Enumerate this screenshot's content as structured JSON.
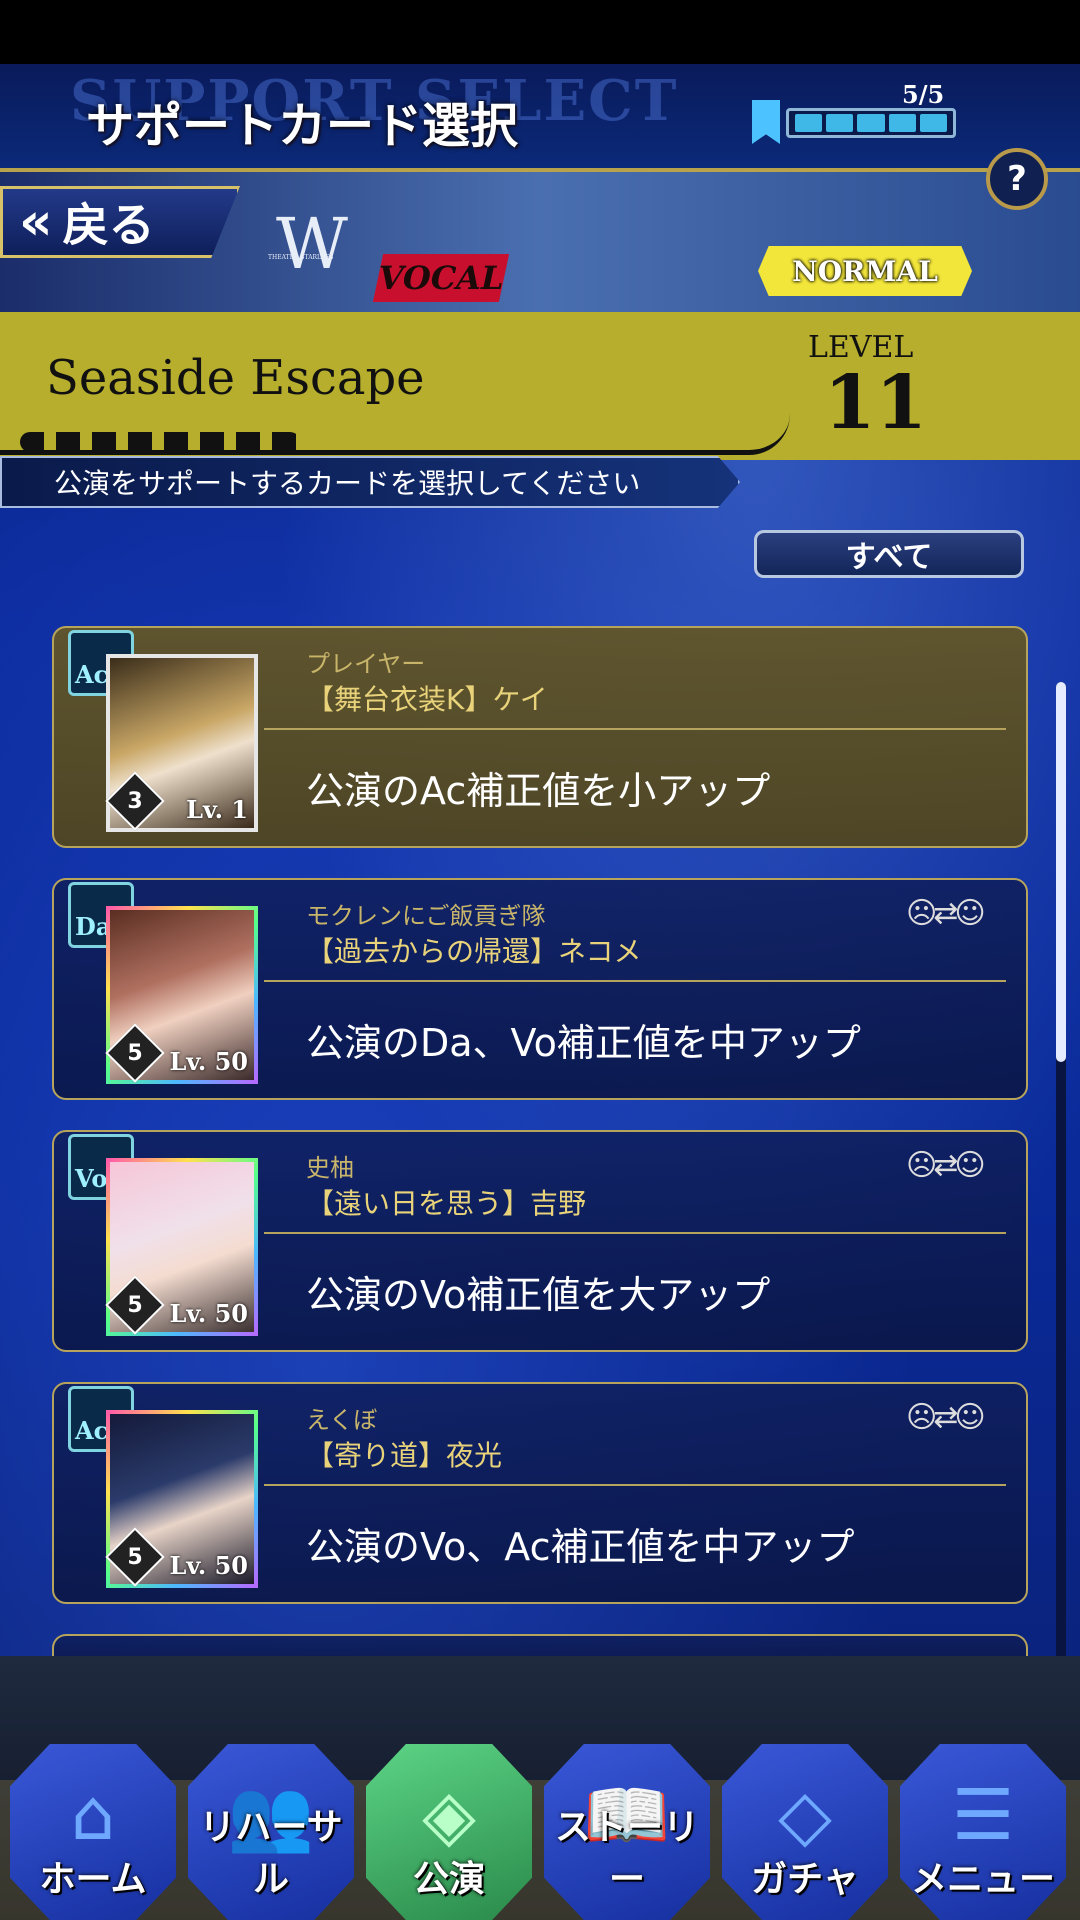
{
  "header": {
    "bg_text": "SUPPORT SELECT",
    "title": "サポートカード選択",
    "stamina": "5/5",
    "help": "?"
  },
  "top": {
    "back_label": "戻る",
    "logo_small": "THEATER STARLESS",
    "attribute": "VOCAL",
    "difficulty": "NORMAL"
  },
  "song": {
    "title": "Seaside Escape",
    "level_label": "LEVEL",
    "level": "11"
  },
  "instruction": "公演をサポートするカードを選択してください",
  "filter_label": "すべて",
  "cards": [
    {
      "type": "Ac",
      "unit": "プレイヤー",
      "name": "【舞台衣装K】ケイ",
      "rank": "3",
      "level": "Lv. 1",
      "effect": "公演のAc補正値を小アップ",
      "selected": true
    },
    {
      "type": "Da",
      "unit": "モクレンにご飯貢ぎ隊",
      "name": "【過去からの帰還】ネコメ",
      "rank": "5",
      "level": "Lv. 50",
      "effect": "公演のDa、Vo補正値を中アップ",
      "selected": false
    },
    {
      "type": "Vo",
      "unit": "史柚",
      "name": "【遠い日を思う】吉野",
      "rank": "5",
      "level": "Lv. 50",
      "effect": "公演のVo補正値を大アップ",
      "selected": false
    },
    {
      "type": "Ac",
      "unit": "えくぼ",
      "name": "【寄り道】夜光",
      "rank": "5",
      "level": "Lv. 50",
      "effect": "公演のVo、Ac補正値を中アップ",
      "selected": false
    }
  ],
  "nav": [
    {
      "label": "ホーム",
      "icon": "home-icon"
    },
    {
      "label": "リハーサル",
      "icon": "rehearsal-icon"
    },
    {
      "label": "公演",
      "icon": "performance-icon"
    },
    {
      "label": "ストーリー",
      "icon": "book-icon"
    },
    {
      "label": "ガチャ",
      "icon": "diamond-icon"
    },
    {
      "label": "メニュー",
      "icon": "menu-icon"
    }
  ],
  "colors": {
    "accent_gold": "#b9a24c",
    "song_band": "#b6ae2c",
    "vocal": "#c8102e",
    "normal": "#f2e63a"
  }
}
